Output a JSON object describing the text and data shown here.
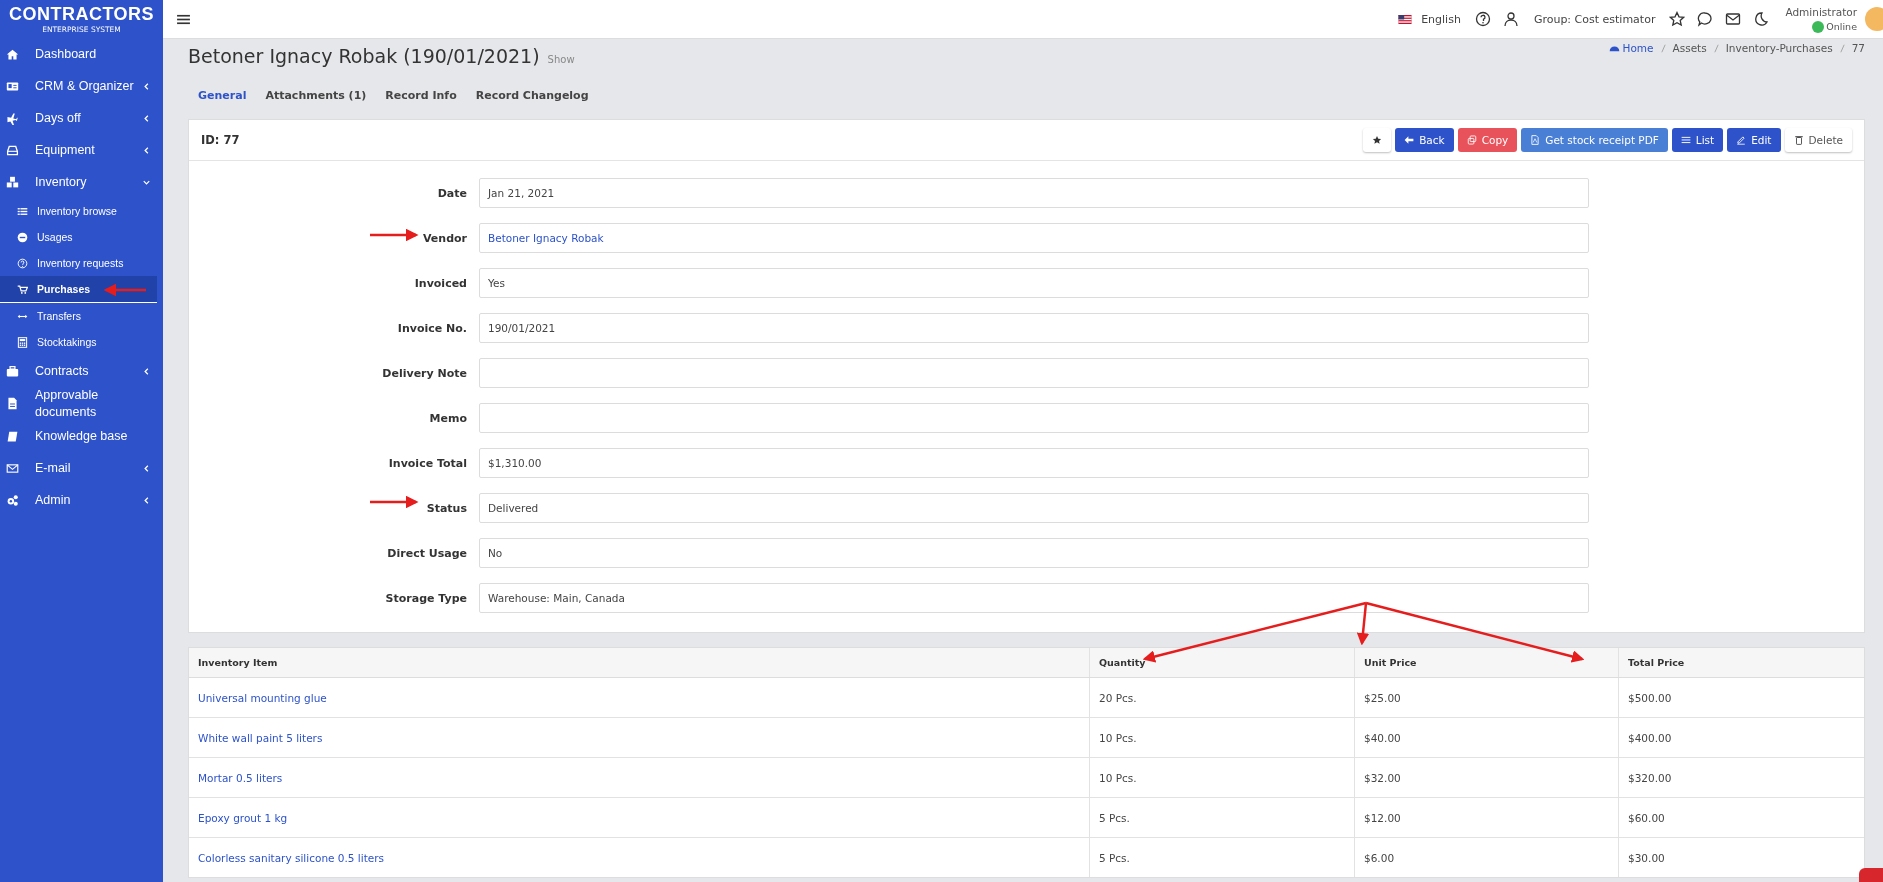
{
  "brand": {
    "name": "CONTRACTORS",
    "tagline": "ENTERPRISE SYSTEM"
  },
  "topbar": {
    "language": "English",
    "group": "Group: Cost estimator",
    "user": "Administrator",
    "status": "Online"
  },
  "sidebar": {
    "items": [
      {
        "label": "Dashboard",
        "selected": false
      },
      {
        "label": "CRM & Organizer",
        "expanded": false,
        "selected": false
      },
      {
        "label": "Days off",
        "expanded": false,
        "selected": false
      },
      {
        "label": "Equipment",
        "expanded": false,
        "selected": false
      },
      {
        "label": "Inventory",
        "expanded": true,
        "selected": false,
        "children": [
          {
            "label": "Inventory browse",
            "selected": false
          },
          {
            "label": "Usages",
            "selected": false
          },
          {
            "label": "Inventory requests",
            "selected": false
          },
          {
            "label": "Purchases",
            "selected": true
          },
          {
            "label": "Transfers",
            "selected": false
          },
          {
            "label": "Stocktakings",
            "selected": false
          }
        ]
      },
      {
        "label": "Contracts",
        "expanded": false,
        "selected": false
      },
      {
        "label": "Approvable documents",
        "selected": false
      },
      {
        "label": "Knowledge base",
        "selected": false
      },
      {
        "label": "E-mail",
        "expanded": false,
        "selected": false
      },
      {
        "label": "Admin",
        "expanded": false,
        "selected": false
      }
    ]
  },
  "page": {
    "title": "Betoner Ignacy Robak (190/01/2021)",
    "subtitle": "Show"
  },
  "breadcrumb": [
    "Home",
    "Assets",
    "Inventory-Purchases",
    "77"
  ],
  "tabs": [
    {
      "label": "General",
      "selected": true
    },
    {
      "label": "Attachments (1)",
      "selected": false
    },
    {
      "label": "Record Info",
      "selected": false
    },
    {
      "label": "Record Changelog",
      "selected": false
    }
  ],
  "record": {
    "id": "ID: 77",
    "buttons": [
      {
        "kind": "star"
      },
      {
        "kind": "back",
        "label": "Back"
      },
      {
        "kind": "copy",
        "label": "Copy"
      },
      {
        "kind": "pdf",
        "label": "Get stock receipt PDF"
      },
      {
        "kind": "list",
        "label": "List"
      },
      {
        "kind": "edit",
        "label": "Edit"
      },
      {
        "kind": "delete",
        "label": "Delete"
      }
    ],
    "fields": [
      {
        "label": "Date",
        "value": "Jan 21, 2021",
        "link": false
      },
      {
        "label": "Vendor",
        "value": "Betoner Ignacy Robak",
        "link": true
      },
      {
        "label": "Invoiced",
        "value": "Yes",
        "link": false
      },
      {
        "label": "Invoice No.",
        "value": "190/01/2021",
        "link": false
      },
      {
        "label": "Delivery Note"
      },
      {
        "label": "Memo"
      },
      {
        "label": "Invoice Total",
        "value": "$1,310.00",
        "link": false
      },
      {
        "label": "Status",
        "value": "Delivered",
        "link": false
      },
      {
        "label": "Direct Usage",
        "value": "No",
        "link": false
      },
      {
        "label": "Storage Type",
        "value": "Warehouse: Main, Canada",
        "link": false
      }
    ]
  },
  "table": {
    "columns": [
      "Inventory Item",
      "Quantity",
      "Unit Price",
      "Total Price"
    ],
    "rows": [
      [
        "Universal mounting glue",
        "20 Pcs.",
        "$25.00",
        "$500.00"
      ],
      [
        "White wall paint 5 liters",
        "10 Pcs.",
        "$40.00",
        "$400.00"
      ],
      [
        "Mortar 0.5 liters",
        "10 Pcs.",
        "$32.00",
        "$320.00"
      ],
      [
        "Epoxy grout 1 kg",
        "5 Pcs.",
        "$12.00",
        "$60.00"
      ],
      [
        "Colorless sanitary silicone 0.5 liters",
        "5 Pcs.",
        "$6.00",
        "$30.00"
      ]
    ]
  }
}
